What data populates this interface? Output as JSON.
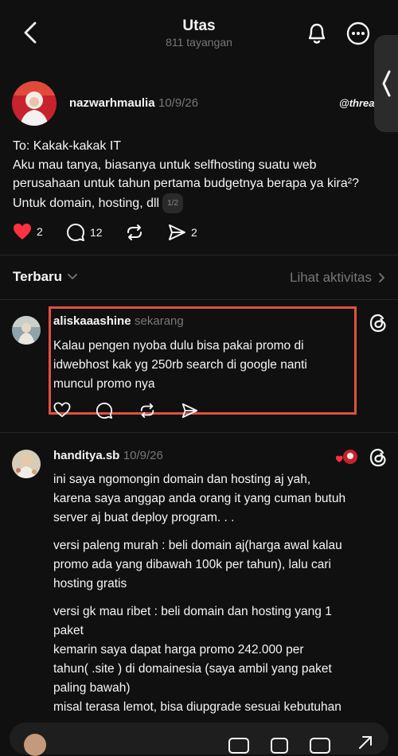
{
  "header": {
    "title": "Utas",
    "subtitle": "811 tayangan"
  },
  "post": {
    "username": "nazwarhmaulia",
    "time": "10/9/26",
    "brand": "threa",
    "lines": [
      "To: Kakak-kakak IT",
      "Aku mau tanya, biasanya untuk selfhosting suatu web",
      "perusahaan untuk tahun pertama budgetnya berapa ya kira²?",
      "Untuk domain, hosting, dll"
    ],
    "page_indicator": "1/2",
    "likes": "2",
    "comments": "12",
    "shares": "2",
    "liked": true
  },
  "sort": {
    "label": "Terbaru",
    "activity_link": "Lihat aktivitas"
  },
  "replies": [
    {
      "username": "aliskaaashine",
      "time": "sekarang",
      "lines": [
        "Kalau pengen nyoba dulu bisa pakai promo di",
        "idwebhost kak yg 250rb search di google nanti",
        "muncul promo nya"
      ],
      "highlighted": true
    },
    {
      "username": "handitya.sb",
      "time": "10/9/26",
      "paragraphs": [
        [
          "ini saya ngomongin domain dan hosting aj yah,",
          "karena saya anggap anda orang it yang cuman butuh",
          "server aj buat deploy program. . ."
        ],
        [
          "versi paleng murah : beli domain aj(harga awal kalau",
          "promo ada yang dibawah 100k per tahun), lalu cari",
          "hosting gratis"
        ],
        [
          "versi gk mau ribet : beli domain dan hosting yang 1",
          "paket",
          "kemarin saya dapat harga promo 242.000 per",
          "tahun( .site ) di domainesia (saya ambil yang paket",
          "paling bawah)",
          "misal terasa lemot, bisa diupgrade sesuai kebutuhan"
        ]
      ]
    }
  ],
  "colors": {
    "background": "#101010",
    "text": "#f3f5f7",
    "muted": "#777777",
    "like_red": "#ff3040",
    "highlight_border": "#e0523f"
  }
}
